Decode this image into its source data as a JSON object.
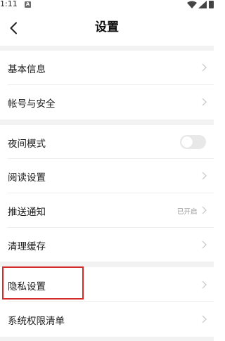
{
  "status_bar": {
    "time": "1:11",
    "notification_badge": "A"
  },
  "header": {
    "title": "设置"
  },
  "settings": {
    "basic_info": "基本信息",
    "account_security": "帐号与安全",
    "night_mode": "夜间模式",
    "night_mode_enabled": false,
    "reading_settings": "阅读设置",
    "push_notifications": "推送通知",
    "push_status": "已开启",
    "clear_cache": "清理缓存",
    "privacy_settings": "隐私设置",
    "system_permissions": "系统权限清单"
  },
  "colors": {
    "background": "#ffffff",
    "group_gap": "#f2f2f2",
    "highlight": "#d42a2a",
    "chevron": "#c4c4c4"
  },
  "icons": {
    "back": "chevron-left-icon",
    "row_arrow": "chevron-right-icon"
  }
}
